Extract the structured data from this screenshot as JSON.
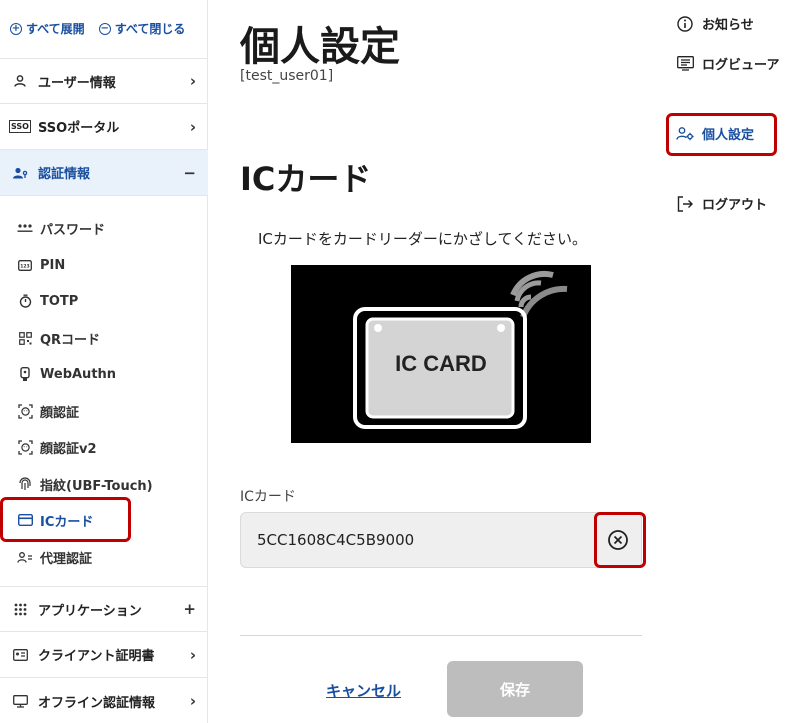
{
  "sidebar": {
    "expand_all": "すべて展開",
    "collapse_all": "すべて閉じる",
    "items": [
      {
        "label": "ユーザー情報",
        "trail": "›"
      },
      {
        "label": "SSOポータル",
        "trail": "›"
      },
      {
        "label": "認証情報",
        "trail": "−"
      },
      {
        "label": "アプリケーション",
        "trail": "+"
      },
      {
        "label": "クライアント証明書",
        "trail": "›"
      },
      {
        "label": "オフライン認証情報",
        "trail": "›"
      }
    ],
    "sub_items": [
      {
        "label": "パスワード",
        "icon": "password-icon"
      },
      {
        "label": "PIN",
        "icon": "pin-icon"
      },
      {
        "label": "TOTP",
        "icon": "stopwatch-icon"
      },
      {
        "label": "QRコード",
        "icon": "qr-icon"
      },
      {
        "label": "WebAuthn",
        "icon": "security-key-icon"
      },
      {
        "label": "顔認証",
        "icon": "face-icon"
      },
      {
        "label": "顔認証v2",
        "icon": "face-v2-icon"
      },
      {
        "label": "指紋(UBF-Touch)",
        "icon": "fingerprint-icon"
      },
      {
        "label": "ICカード",
        "icon": "card-icon"
      },
      {
        "label": "代理認証",
        "icon": "proxy-user-icon"
      }
    ],
    "sso_badge": "SSO"
  },
  "main": {
    "page_title": "個人設定",
    "user_id": "[test_user01]",
    "section_title": "ICカード",
    "instruction": "ICカードをカードリーダーにかざしてください。",
    "card_image_text": "IC CARD",
    "field_label": "ICカード",
    "field_value": "5CC1608C4C5B9000",
    "cancel_label": "キャンセル",
    "save_label": "保存"
  },
  "right_menu": [
    {
      "label": "お知らせ",
      "icon": "info-icon"
    },
    {
      "label": "ログビューア",
      "icon": "log-viewer-icon"
    },
    {
      "label": "個人設定",
      "icon": "user-settings-icon"
    },
    {
      "label": "ログアウト",
      "icon": "logout-icon"
    }
  ],
  "colors": {
    "accent": "#1a4fa0",
    "highlight_box": "#c00000",
    "active_bg": "#e9f2fb",
    "disabled_button": "#bdbdbd"
  }
}
